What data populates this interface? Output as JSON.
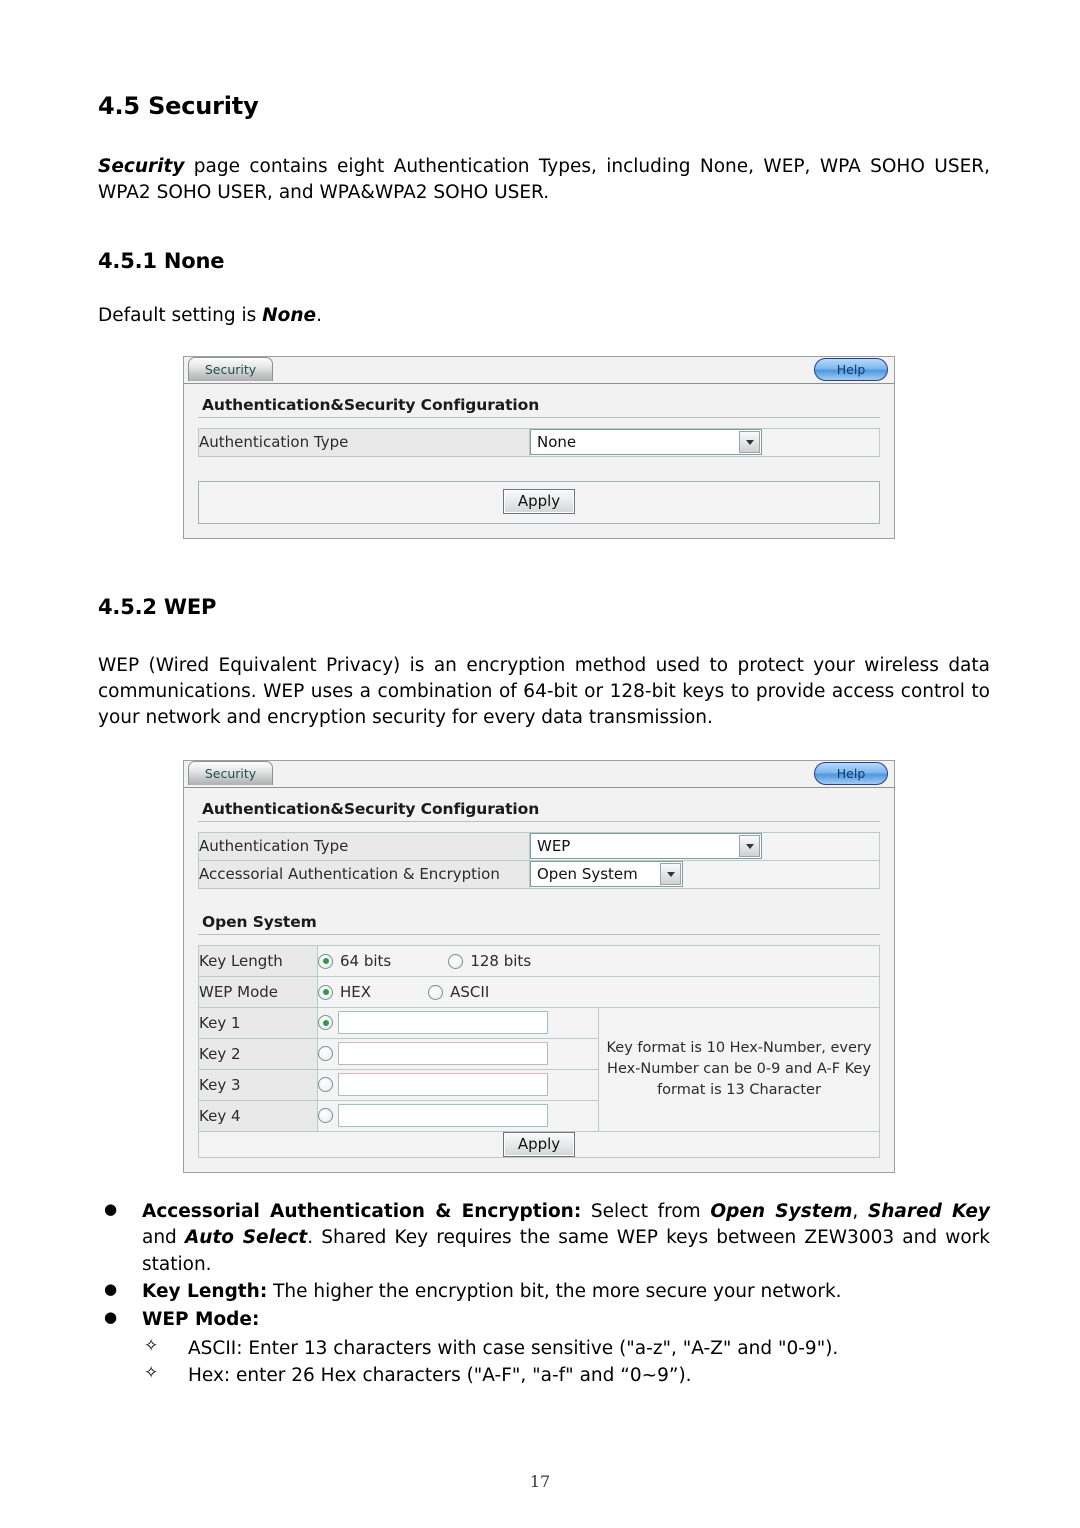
{
  "document": {
    "section_heading": "4.5 Security",
    "intro": {
      "lead": "Security",
      "rest": " page contains eight Authentication Types, including None, WEP, WPA SOHO USER, WPA2 SOHO USER, and WPA&WPA2 SOHO USER."
    },
    "sub1_heading": "4.5.1 None",
    "sub1_text_pre": "Default setting is ",
    "sub1_text_em": "None",
    "sub1_text_post": ".",
    "sub2_heading": "4.5.2 WEP",
    "sub2_para": "WEP (Wired Equivalent Privacy) is an encryption method used to protect your wireless data communications. WEP uses a combination of 64-bit or 128-bit keys to provide access control to your network and encryption security for every data transmission.",
    "page_number": "17"
  },
  "panel_none": {
    "tab_label": "Security",
    "help_label": "Help",
    "section_title": "Authentication&Security Configuration",
    "rows": [
      {
        "label": "Authentication Type",
        "value": "None"
      }
    ],
    "apply_label": "Apply"
  },
  "panel_wep": {
    "tab_label": "Security",
    "help_label": "Help",
    "section_title": "Authentication&Security Configuration",
    "rows": [
      {
        "label": "Authentication Type",
        "value": "WEP"
      },
      {
        "label": "Accessorial Authentication & Encryption",
        "value": "Open System"
      }
    ],
    "open_system_title": "Open System",
    "key_length": {
      "label": "Key Length",
      "options": [
        {
          "label": "64 bits",
          "selected": true
        },
        {
          "label": "128 bits",
          "selected": false
        }
      ]
    },
    "wep_mode": {
      "label": "WEP Mode",
      "options": [
        {
          "label": "HEX",
          "selected": true
        },
        {
          "label": "ASCII",
          "selected": false
        }
      ]
    },
    "keys": [
      {
        "label": "Key 1",
        "selected": true,
        "value": ""
      },
      {
        "label": "Key 2",
        "selected": false,
        "value": ""
      },
      {
        "label": "Key 3",
        "selected": false,
        "value": ""
      },
      {
        "label": "Key 4",
        "selected": false,
        "value": ""
      }
    ],
    "hint": "Key format is 10 Hex-Number, every Hex-Number can be 0-9 and A-F Key format is 13 Character",
    "apply_label": "Apply"
  },
  "notes": {
    "bullet1": {
      "term": "Accessorial Authentication & Encryption:",
      "seg1": " Select from ",
      "em1": "Open System",
      "seg2": ", ",
      "em2": "Shared Key",
      "seg3": " and ",
      "em3": "Auto Select",
      "seg4": ". Shared Key requires the same WEP keys between ZEW3003 and work station."
    },
    "bullet2": {
      "term": "Key Length:",
      "text": " The higher the encryption bit, the more secure your network."
    },
    "bullet3": {
      "term": "WEP Mode:"
    },
    "sub_bullets": [
      "ASCII: Enter 13 characters with case sensitive (\"a-z\", \"A-Z\" and \"0-9\").",
      "Hex: enter 26 Hex characters (\"A-F\", \"a-f\" and “0~9”)."
    ]
  },
  "colors": {
    "panel_bg": "#f2f2f2",
    "label_bg": "#e9e9e9",
    "grid_border": "#b9cbc9",
    "tab_text": "#1d4f4f",
    "help_blue": "#4f97e0",
    "radio_dot": "#2f9b46"
  }
}
